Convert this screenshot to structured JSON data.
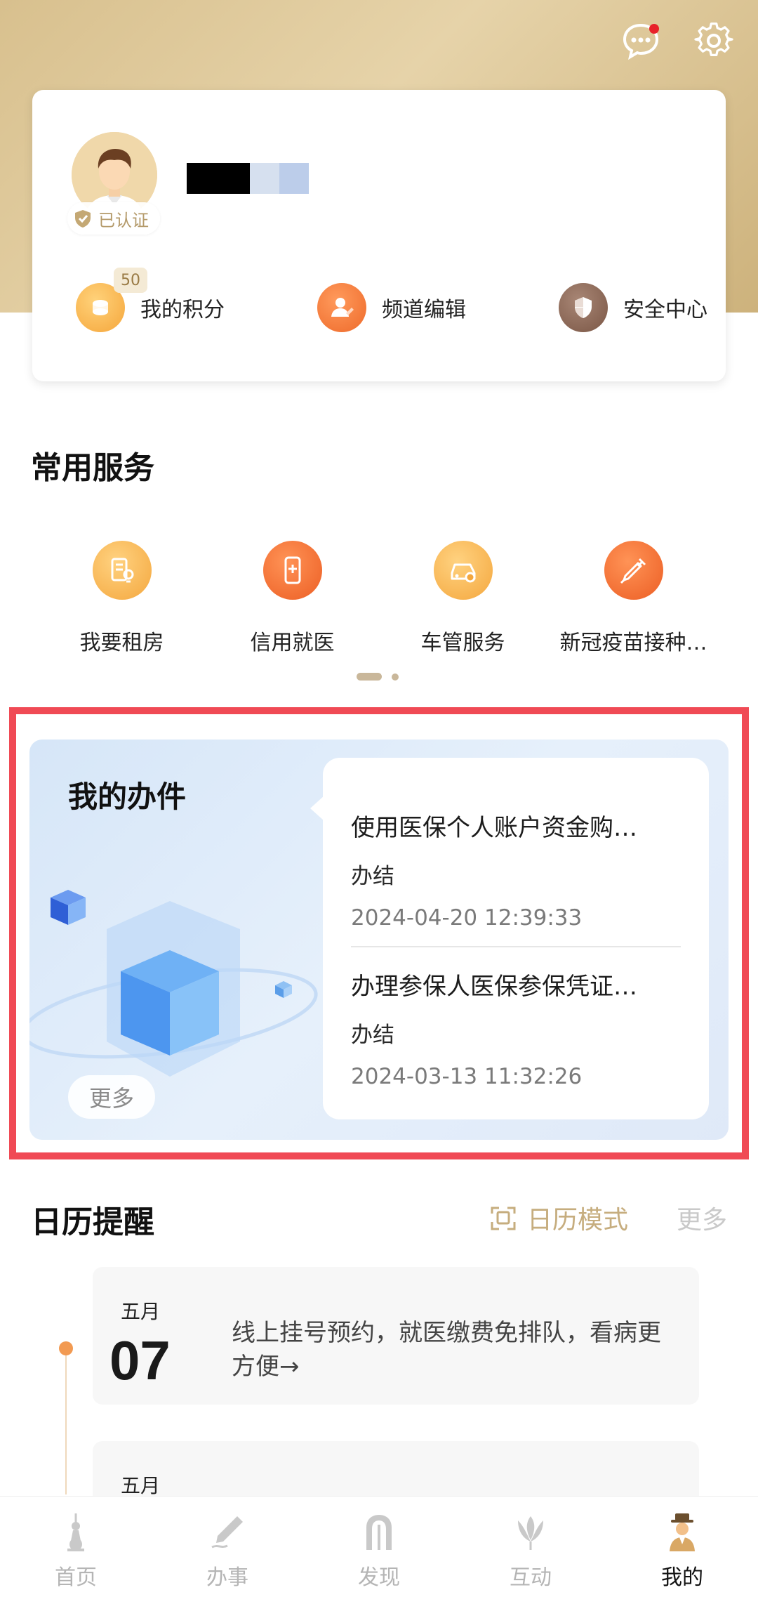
{
  "header": {
    "message_icon": "chat-bubble-icon",
    "settings_icon": "gear-icon",
    "has_unread": true
  },
  "profile": {
    "verified_label": "已认证",
    "points_badge": "50",
    "quick_actions": [
      {
        "label": "我的积分",
        "icon": "coin-stack-icon"
      },
      {
        "label": "频道编辑",
        "icon": "user-edit-icon"
      },
      {
        "label": "安全中心",
        "icon": "shield-icon"
      }
    ]
  },
  "common_services": {
    "title": "常用服务",
    "items": [
      {
        "label": "我要租房",
        "icon": "rent-house-icon"
      },
      {
        "label": "信用就医",
        "icon": "medical-phone-icon"
      },
      {
        "label": "车管服务",
        "icon": "car-icon"
      },
      {
        "label": "新冠疫苗接种…",
        "icon": "syringe-icon"
      }
    ]
  },
  "my_work": {
    "title": "我的办件",
    "more_label": "更多",
    "items": [
      {
        "title": "使用医保个人账户资金购…",
        "status": "办结",
        "time": "2024-04-20 12:39:33"
      },
      {
        "title": "办理参保人医保参保凭证…",
        "status": "办结",
        "time": "2024-03-13 11:32:26"
      }
    ]
  },
  "calendar": {
    "title": "日历提醒",
    "mode_label": "日历模式",
    "more_label": "更多",
    "entries": [
      {
        "month": "五月",
        "day": "07",
        "text": "线上挂号预约，就医缴费免排队，看病更方便→"
      },
      {
        "month": "五月",
        "day": "",
        "text": ""
      }
    ]
  },
  "tabbar": {
    "items": [
      {
        "label": "首页",
        "icon": "tower-icon",
        "active": false
      },
      {
        "label": "办事",
        "icon": "pen-icon",
        "active": false
      },
      {
        "label": "发现",
        "icon": "arch-icon",
        "active": false
      },
      {
        "label": "互动",
        "icon": "tulip-icon",
        "active": false
      },
      {
        "label": "我的",
        "icon": "person-hat-icon",
        "active": true
      }
    ]
  },
  "colors": {
    "hero_gold": "#d8c08e",
    "accent_orange": "#f29a52",
    "highlight_red": "#f04a55"
  }
}
